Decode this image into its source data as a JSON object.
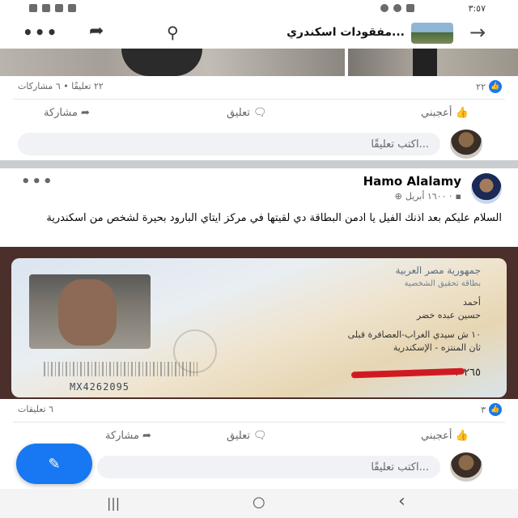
{
  "status_bar": {
    "time": "٣:٥٧"
  },
  "header": {
    "title": "مفقودات اسكندري...",
    "icons": [
      "back-arrow-icon",
      "search-icon",
      "share-icon",
      "more-icon"
    ]
  },
  "post1": {
    "likes_count": "٢٢",
    "stats": "٢٢ تعليقًا • ٦ مشاركات",
    "like_label": "أعجبني",
    "comment_label": "تعليق",
    "share_label": "مشاركة",
    "comment_placeholder": "اكتب تعليقًا..."
  },
  "post2": {
    "author": "Hamo Alalamy",
    "meta": "١٦٠٠ أبريل ·",
    "text": "السلام عليكم بعد اذنك الفيل يا ادمن البطاقة دي لقيتها في مركز ايتاي البارود بحيرة لشخص من اسكندرية",
    "id_card": {
      "heading": "جمهورية مصر العربية",
      "subheading": "بطاقة تحقيق الشخصية",
      "name_first": "أحمد",
      "name_rest": "حسين عبده خضر",
      "address1": "١٠ ش سيدي الغراب-العصافرة قبلى",
      "address2": "ثان المنتزه - الإسكندرية",
      "number": "٢٦٥ ٠٣",
      "serial": "MX4262095"
    },
    "likes_count": "٣",
    "stats": "٦ تعليقات",
    "like_label": "أعجبني",
    "comment_label": "تعليق",
    "share_label": "مشاركة",
    "comment_placeholder": "اكتب تعليقًا..."
  },
  "fab": {
    "icon": "compose-icon"
  },
  "navbar": {
    "recent": "|||",
    "home": "○",
    "back": "‹"
  },
  "colors": {
    "accent": "#1877f2",
    "background": "#c9ccd1"
  }
}
